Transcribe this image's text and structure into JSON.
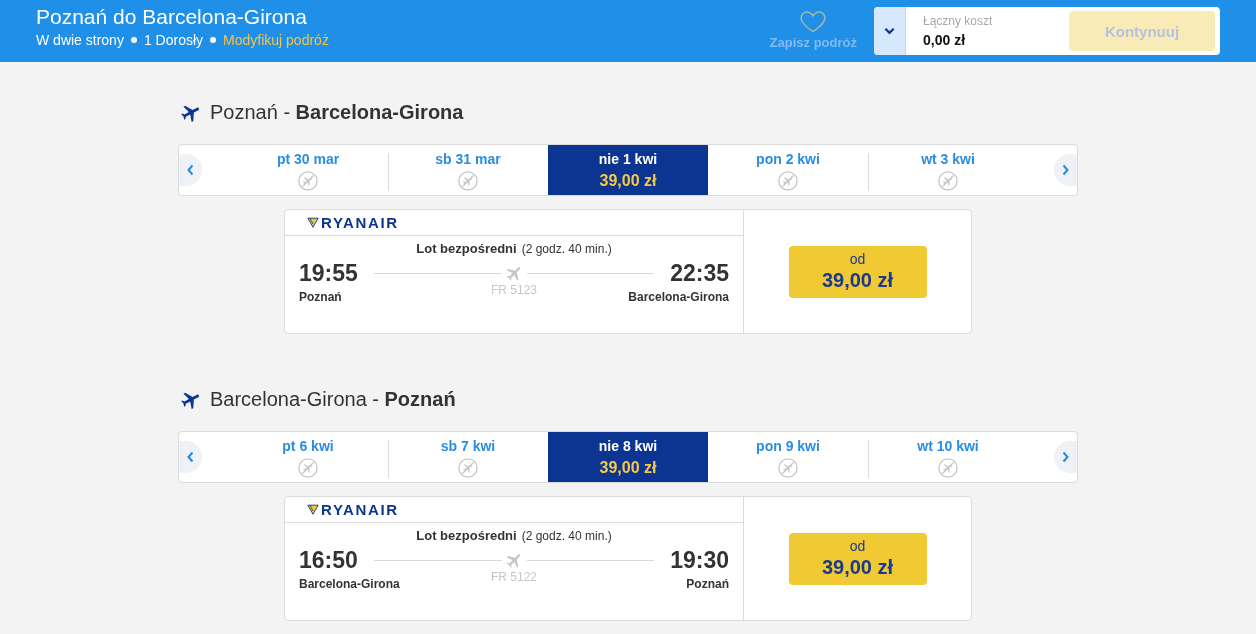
{
  "header": {
    "title": "Poznań do Barcelona-Girona",
    "trip_type": "W dwie strony",
    "passengers": "1 Dorosły",
    "modify_link": "Modyfikuj podróż",
    "save_trip": {
      "label": "Zapisz podróż",
      "disabled": true
    },
    "total": {
      "label": "Łączny koszt",
      "value": "0,00 zł"
    },
    "continue_button": {
      "label": "Kontynuuj",
      "disabled": true
    }
  },
  "legs": [
    {
      "heading": "Poznań - **Barcelona-Girona**",
      "dates": [
        {
          "label": "pt 30 mar",
          "available": false,
          "selected": false
        },
        {
          "label": "sb 31 mar",
          "available": false,
          "selected": false
        },
        {
          "label": "nie 1 kwi",
          "available": true,
          "price": "39,00 zł",
          "selected": true
        },
        {
          "label": "pon 2 kwi",
          "available": false,
          "selected": false
        },
        {
          "label": "wt 3 kwi",
          "available": false,
          "selected": false
        }
      ],
      "flight": {
        "airline": "RYANAIR",
        "type": "Lot bezpośredni",
        "duration": "(2 godz. 40 min.)",
        "departure_time": "19:55",
        "departure_city": "Poznań",
        "flight_number": "FR 5123",
        "arrival_time": "22:35",
        "arrival_city": "Barcelona-Girona",
        "price_prefix": "od",
        "price": "39,00 zł"
      }
    },
    {
      "heading": "Barcelona-Girona - **Poznań**",
      "dates": [
        {
          "label": "pt 6 kwi",
          "available": false,
          "selected": false
        },
        {
          "label": "sb 7 kwi",
          "available": false,
          "selected": false
        },
        {
          "label": "nie 8 kwi",
          "available": true,
          "price": "39,00 zł",
          "selected": true
        },
        {
          "label": "pon 9 kwi",
          "available": false,
          "selected": false
        },
        {
          "label": "wt 10 kwi",
          "available": false,
          "selected": false
        }
      ],
      "flight": {
        "airline": "RYANAIR",
        "type": "Lot bezpośredni",
        "duration": "(2 godz. 40 min.)",
        "departure_time": "16:50",
        "departure_city": "Barcelona-Girona",
        "flight_number": "FR 5122",
        "arrival_time": "19:30",
        "arrival_city": "Poznań",
        "price_prefix": "od",
        "price": "39,00 zł"
      }
    }
  ]
}
